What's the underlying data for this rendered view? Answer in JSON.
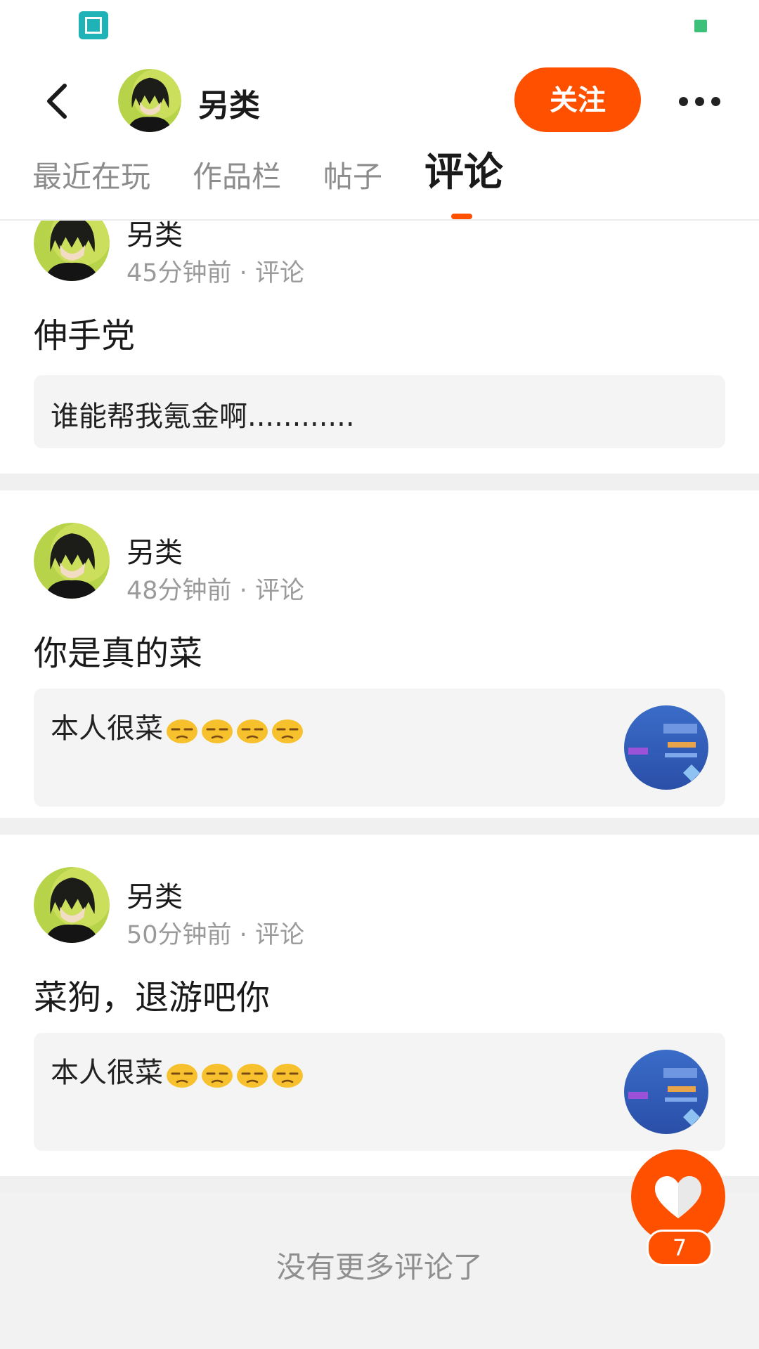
{
  "header": {
    "name": "另类",
    "follow_label": "关注"
  },
  "tabs": [
    {
      "label": "最近在玩",
      "active": false
    },
    {
      "label": "作品栏",
      "active": false
    },
    {
      "label": "帖子",
      "active": false
    },
    {
      "label": "评论",
      "active": true
    }
  ],
  "comments": [
    {
      "author": "另类",
      "time": "45分钟前",
      "type": "评论",
      "text": "伸手党",
      "quote": "谁能帮我氪金啊............",
      "has_thumbnail": false
    },
    {
      "author": "另类",
      "time": "48分钟前",
      "type": "评论",
      "text": "你是真的菜",
      "quote": "本人很菜",
      "has_thumbnail": true
    },
    {
      "author": "另类",
      "time": "50分钟前",
      "type": "评论",
      "text": "菜狗，退游吧你",
      "quote": "本人很菜",
      "has_thumbnail": true
    }
  ],
  "footer": {
    "no_more": "没有更多评论了"
  },
  "like": {
    "count": "7"
  },
  "colors": {
    "accent": "#ff5000",
    "status_dot": "#3cc07a",
    "scan_icon": "#1fb3b8"
  },
  "icons": {
    "emoji": "unamused-face-icon",
    "like": "heart-icon",
    "back": "back-arrow-icon",
    "more": "more-dots-icon"
  }
}
